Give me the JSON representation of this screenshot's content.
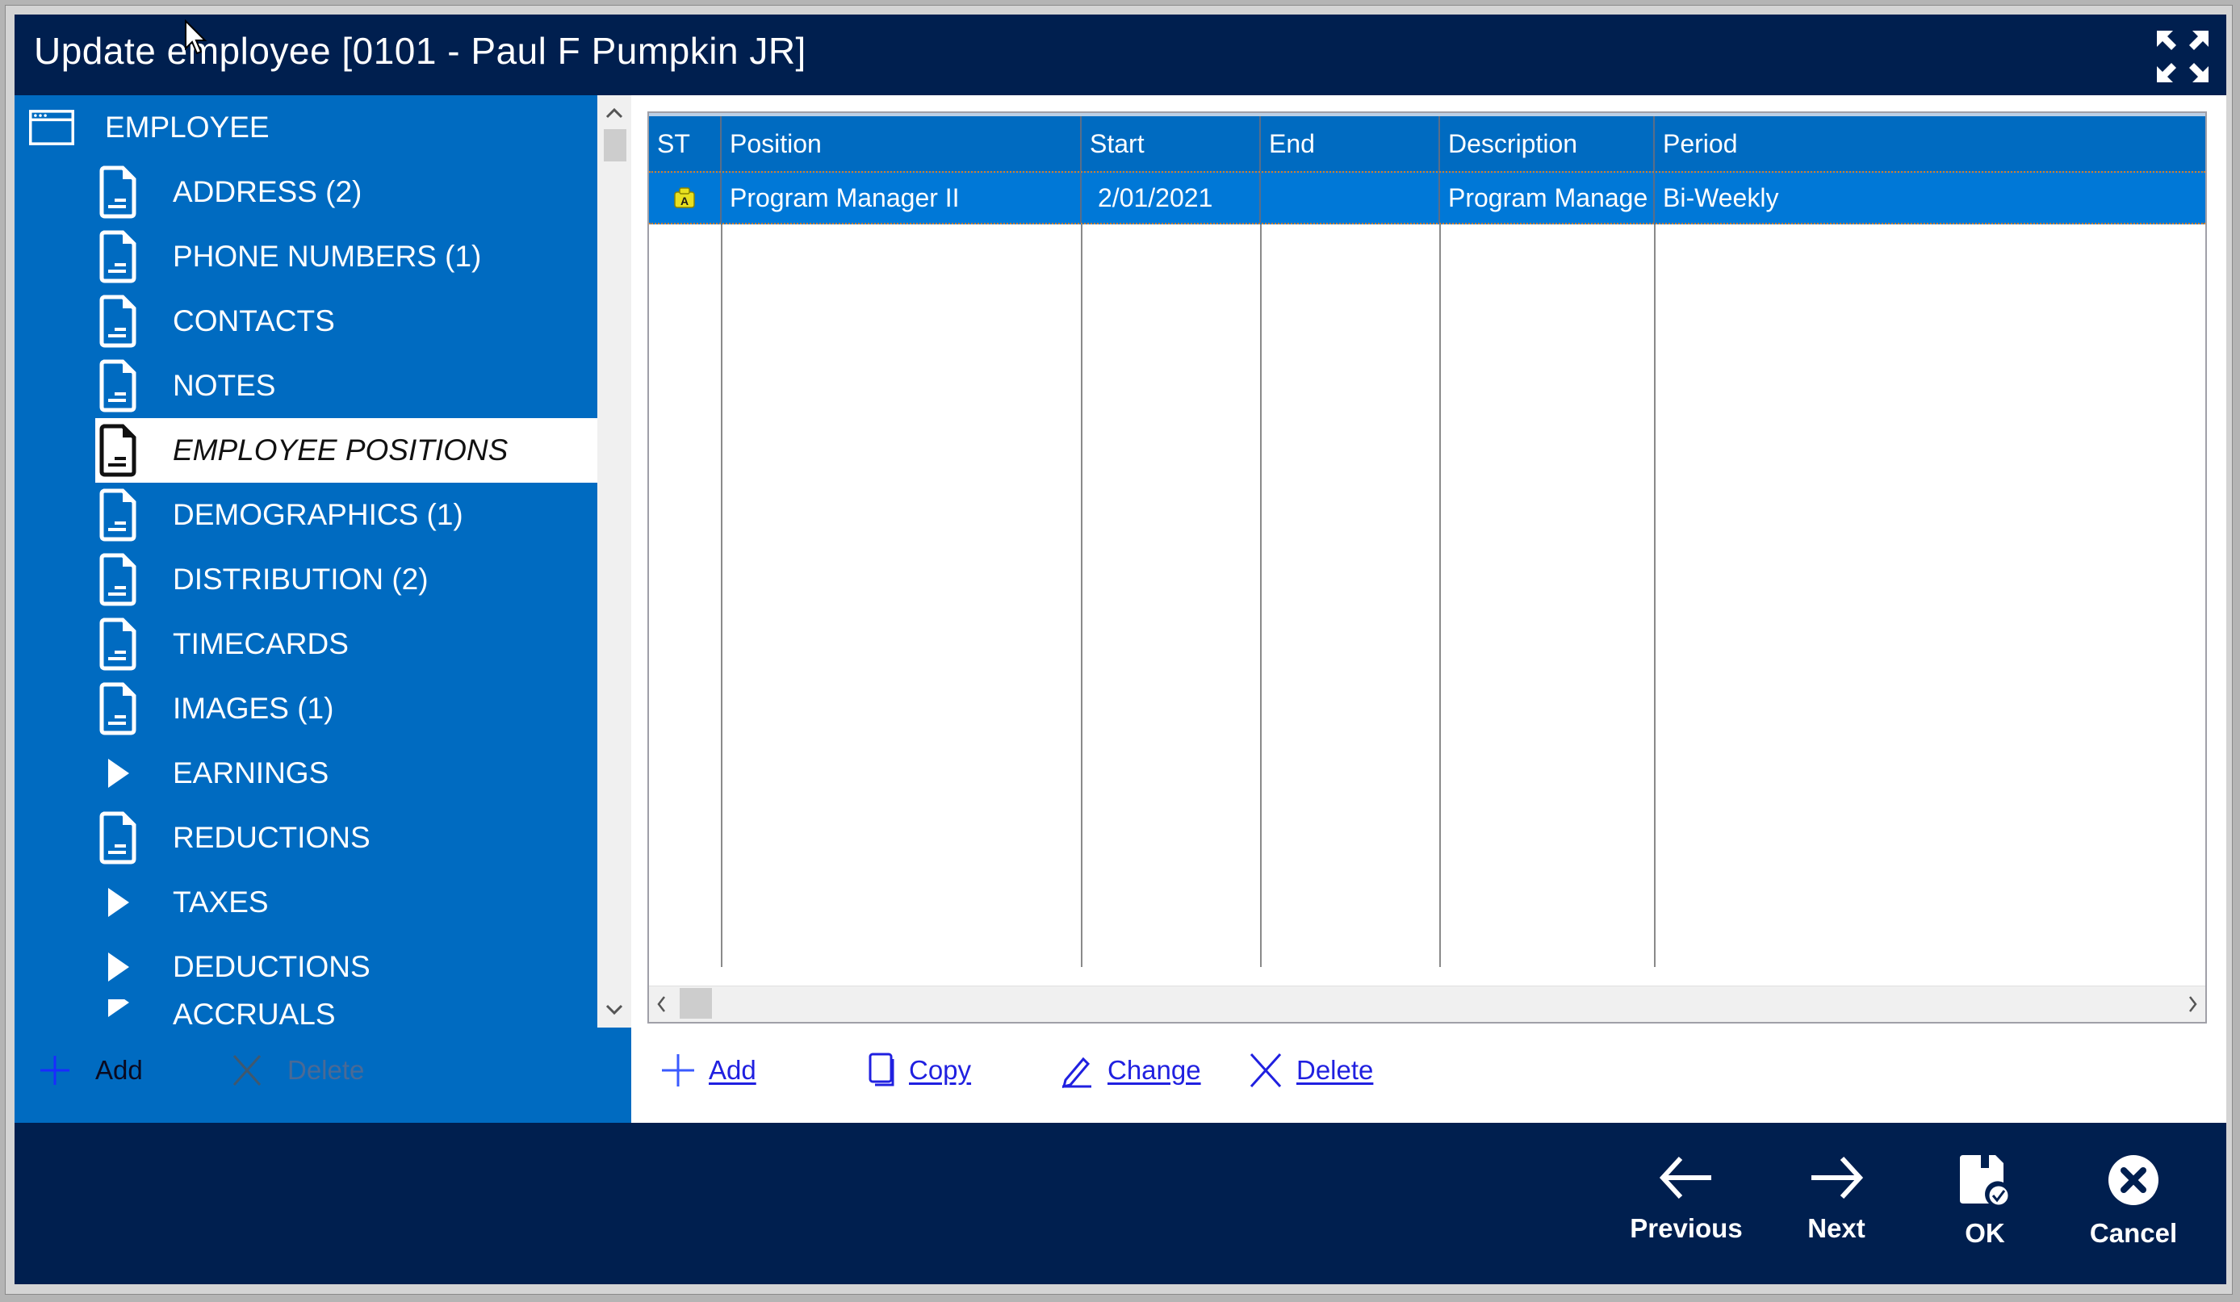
{
  "window": {
    "title": "Update employee [0101 - Paul F Pumpkin JR]",
    "maximize_icon": "expand-arrows-icon"
  },
  "sidebar": {
    "root": {
      "label": "EMPLOYEE",
      "icon": "window-icon"
    },
    "items": [
      {
        "label": "ADDRESS (2)",
        "icon": "document-icon",
        "selected": false
      },
      {
        "label": "PHONE NUMBERS (1)",
        "icon": "document-icon",
        "selected": false
      },
      {
        "label": "CONTACTS",
        "icon": "document-icon",
        "selected": false
      },
      {
        "label": "NOTES",
        "icon": "document-icon",
        "selected": false
      },
      {
        "label": "EMPLOYEE POSITIONS",
        "icon": "document-icon",
        "selected": true
      },
      {
        "label": "DEMOGRAPHICS (1)",
        "icon": "document-icon",
        "selected": false
      },
      {
        "label": "DISTRIBUTION (2)",
        "icon": "document-icon",
        "selected": false
      },
      {
        "label": "TIMECARDS",
        "icon": "document-icon",
        "selected": false
      },
      {
        "label": "IMAGES (1)",
        "icon": "document-icon",
        "selected": false
      },
      {
        "label": "EARNINGS",
        "icon": "expand-triangle-icon",
        "selected": false
      },
      {
        "label": "REDUCTIONS",
        "icon": "document-icon",
        "selected": false
      },
      {
        "label": "TAXES",
        "icon": "expand-triangle-icon",
        "selected": false
      },
      {
        "label": "DEDUCTIONS",
        "icon": "expand-triangle-icon",
        "selected": false
      },
      {
        "label": "ACCRUALS",
        "icon": "expand-triangle-icon",
        "selected": false
      }
    ],
    "actions": {
      "add_label": "Add",
      "delete_label": "Delete"
    }
  },
  "grid": {
    "columns": [
      "ST",
      "Position",
      "Start",
      "End",
      "Description",
      "Period"
    ],
    "rows": [
      {
        "status_icon": "active-lock-icon",
        "position": "Program Manager II",
        "start": "2/01/2021",
        "end": "",
        "description": "Program Manage",
        "period": "Bi-Weekly"
      }
    ],
    "actions": {
      "add_label": "Add",
      "copy_label": "Copy",
      "change_label": "Change",
      "delete_label": "Delete"
    }
  },
  "footer": {
    "previous_label": "Previous",
    "next_label": "Next",
    "ok_label": "OK",
    "cancel_label": "Cancel"
  },
  "colors": {
    "title_bg": "#001f4f",
    "sidebar_bg": "#006bc1",
    "row_selected": "#0078d7",
    "link_blue": "#2020e0"
  }
}
